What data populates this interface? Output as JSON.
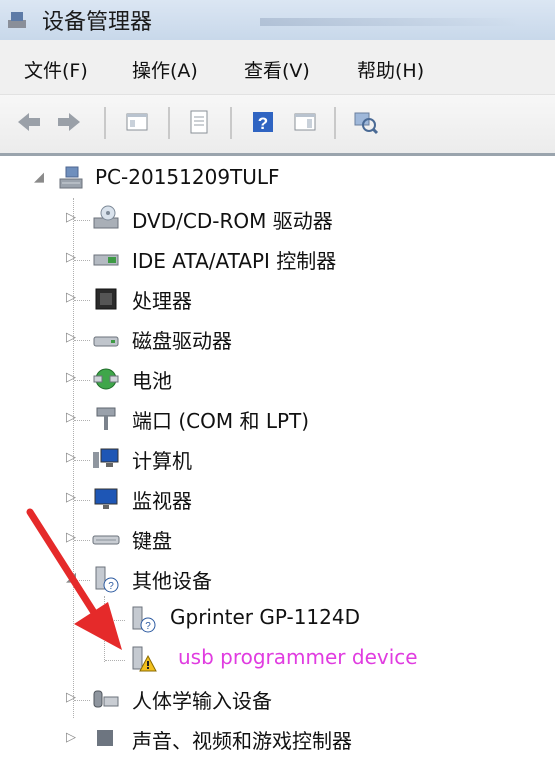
{
  "window": {
    "title": "设备管理器"
  },
  "menu": {
    "file": "文件(F)",
    "action": "操作(A)",
    "view": "查看(V)",
    "help": "帮助(H)"
  },
  "toolbar": {
    "buttons": [
      "back-icon",
      "forward-icon",
      "console-tree-icon",
      "properties-icon",
      "help-icon",
      "action-pane-icon",
      "scan-hardware-icon"
    ]
  },
  "tree": {
    "root": "PC-20151209TULF",
    "items": [
      "DVD/CD-ROM 驱动器",
      "IDE ATA/ATAPI 控制器",
      "处理器",
      "磁盘驱动器",
      "电池",
      "端口 (COM 和 LPT)",
      "计算机",
      "监视器",
      "键盘",
      "其他设备",
      "Gprinter GP-1124D",
      "usb programmer device",
      "人体学输入设备",
      "声音、视频和游戏控制器"
    ]
  },
  "colors": {
    "warning_text": "#e03ce0",
    "arrow": "#e52a2a"
  }
}
